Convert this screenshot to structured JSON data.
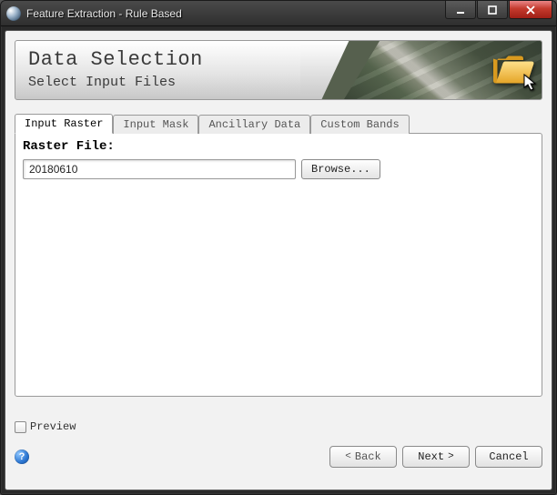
{
  "window": {
    "title": "Feature Extraction - Rule Based"
  },
  "banner": {
    "title": "Data Selection",
    "subtitle": "Select Input Files"
  },
  "tabs": [
    {
      "label": "Input Raster",
      "active": true
    },
    {
      "label": "Input Mask",
      "active": false
    },
    {
      "label": "Ancillary Data",
      "active": false
    },
    {
      "label": "Custom Bands",
      "active": false
    }
  ],
  "panel": {
    "raster_label": "Raster File:",
    "raster_value": "20180610",
    "browse_label": "Browse..."
  },
  "preview": {
    "label": "Preview",
    "checked": false
  },
  "footer": {
    "back_label": "Back",
    "next_label": "Next",
    "cancel_label": "Cancel"
  },
  "icons": {
    "help_glyph": "?"
  }
}
